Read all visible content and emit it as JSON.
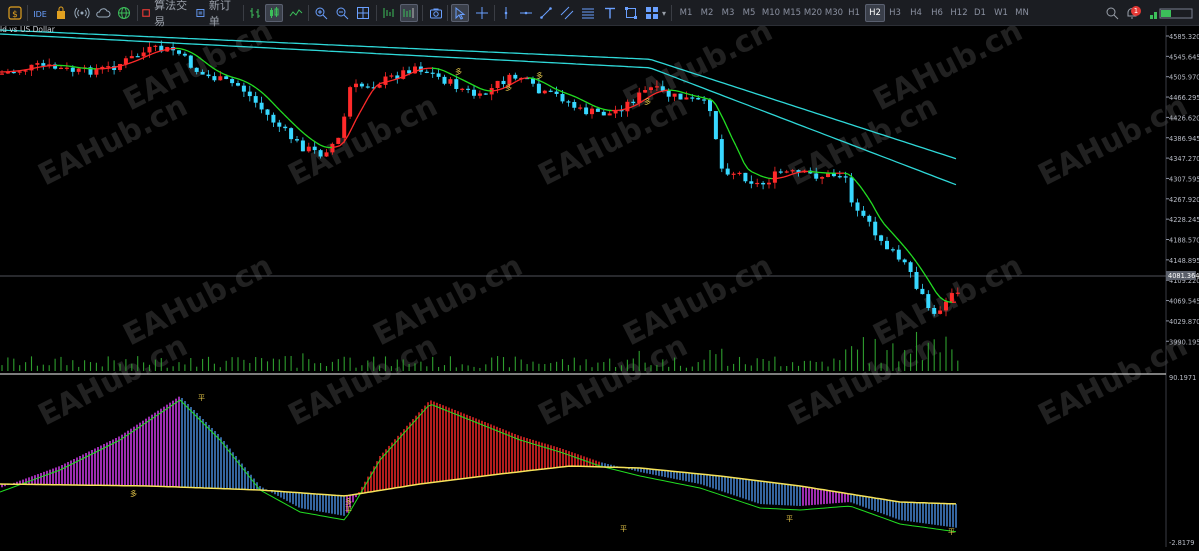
{
  "toolbar": {
    "algo_trading_label": "算法交易",
    "new_order_label": "新订单",
    "timeframes": [
      "M1",
      "M2",
      "M3",
      "M5",
      "M10",
      "M15",
      "M20",
      "M30",
      "H1",
      "H2",
      "H3",
      "H4",
      "H6",
      "H12",
      "D1",
      "W1",
      "MN"
    ],
    "active_timeframe": "H2",
    "notification_count": "1"
  },
  "chart": {
    "symbol_label": "ld vs US Dollar",
    "current_price_label": "4081.364",
    "price_axis_labels": [
      "4585.320",
      "4545.645",
      "4505.970",
      "4466.295",
      "4426.620",
      "4386.945",
      "4347.270",
      "4307.595",
      "4267.920",
      "4228.245",
      "4188.570",
      "4148.895",
      "4109.220",
      "4069.545",
      "4029.870",
      "3990.195"
    ],
    "indicator_max_label": "90.1971",
    "indicator_min_label": "-2.8179",
    "signal_marks": [
      "多",
      "多",
      "多",
      "多",
      "平",
      "平",
      "平",
      "平",
      "平"
    ],
    "watermark": "EAHub.cn",
    "colors": {
      "bull_candle": "#ff2a2a",
      "bear_candle": "#38d8ff",
      "fast_ma_up": "#ff2a2a",
      "fast_ma_down": "#22dd22",
      "slow_ma": "#2fd8d8",
      "volume": "#2e9e2e",
      "macd_bull": "#e040fb",
      "macd_bear": "#4a90e2",
      "signal_line": "#f6e35a"
    }
  }
}
